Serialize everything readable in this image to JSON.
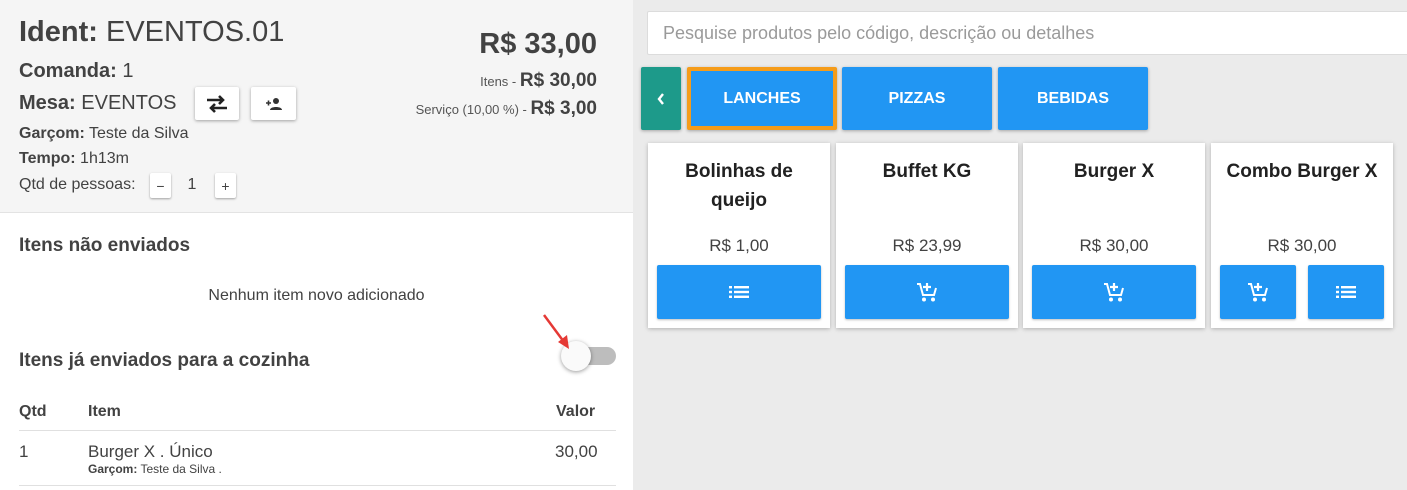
{
  "order": {
    "ident_label": "Ident:",
    "ident_value": "EVENTOS.01",
    "comanda_label": "Comanda:",
    "comanda_value": "1",
    "mesa_label": "Mesa:",
    "mesa_value": "EVENTOS",
    "garcom_label": "Garçom:",
    "garcom_value": "Teste da Silva",
    "tempo_label": "Tempo:",
    "tempo_value": "1h13m",
    "pessoas_label": "Qtd de pessoas:",
    "pessoas_minus": "−",
    "pessoas_value": "1",
    "pessoas_plus": "+"
  },
  "totals": {
    "total": "R$ 33,00",
    "itens_label": "Itens - ",
    "itens_value": "R$ 30,00",
    "servico_label": "Serviço (10,00 %) - ",
    "servico_value": "R$ 3,00"
  },
  "unsent": {
    "title": "Itens não enviados",
    "empty_message": "Nenhum item novo adicionado"
  },
  "sent": {
    "title": "Itens já enviados para a cozinha",
    "toggle_on": false,
    "columns": {
      "qtd": "Qtd",
      "item": "Item",
      "valor": "Valor"
    },
    "rows": [
      {
        "qtd": "1",
        "item": "Burger X . Único",
        "garcom_label": "Garçom:",
        "garcom_value": "Teste da Silva .",
        "valor": "30,00"
      }
    ]
  },
  "search": {
    "placeholder": "Pesquise produtos pelo código, descrição ou detalhes",
    "value": ""
  },
  "categories": [
    {
      "label": "LANCHES",
      "active": true
    },
    {
      "label": "PIZZAS",
      "active": false
    },
    {
      "label": "BEBIDAS",
      "active": false
    }
  ],
  "products": [
    {
      "name": "Bolinhas de queijo",
      "price": "R$ 1,00",
      "buttons": [
        "list-icon"
      ]
    },
    {
      "name": "Buffet KG",
      "price": "R$ 23,99",
      "buttons": [
        "add-to-cart-icon"
      ]
    },
    {
      "name": "Burger X",
      "price": "R$ 30,00",
      "buttons": [
        "add-to-cart-icon"
      ]
    },
    {
      "name": "Combo Burger X",
      "price": "R$ 30,00",
      "buttons": [
        "add-to-cart-icon",
        "list-icon"
      ]
    }
  ],
  "colors": {
    "accent_blue": "#2196f3",
    "teal": "#1d9a8a",
    "active_border": "#f59c1a",
    "annotation_arrow": "#e53935"
  },
  "icons": {
    "back": "chevron-left-icon",
    "transfer": "swap-icon",
    "add_person": "person-add-icon",
    "annotation": "red-arrow-icon"
  }
}
